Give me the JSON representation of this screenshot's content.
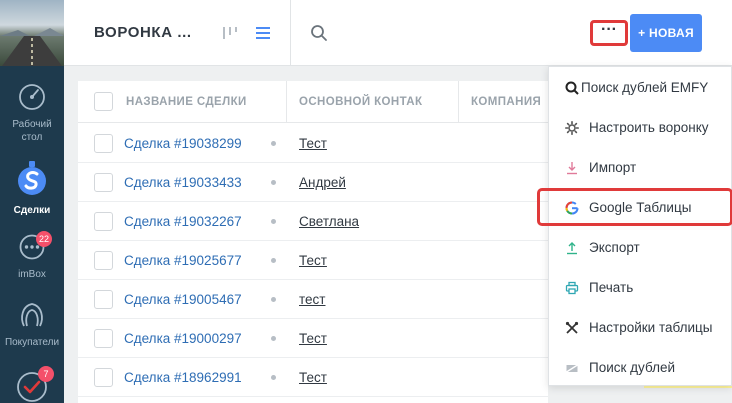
{
  "sidebar": {
    "items": [
      {
        "label": "Рабочий стол",
        "label_line1": "Рабочий",
        "label_line2": "стол",
        "icon": "speedometer-icon"
      },
      {
        "label": "Сделки",
        "icon": "deals-icon",
        "active": true
      },
      {
        "label": "imBox",
        "icon": "chat-icon",
        "badge": "22"
      },
      {
        "label": "Покупатели",
        "icon": "buyers-icon"
      },
      {
        "label": "",
        "icon": "tasks-check-icon",
        "badge": "7"
      }
    ]
  },
  "header": {
    "title": "ВОРОНКА ...",
    "more_label": "···",
    "new_label": "+ НОВАЯ"
  },
  "table": {
    "columns": [
      "НАЗВАНИЕ СДЕЛКИ",
      "ОСНОВНОЙ КОНТАК",
      "КОМПАНИЯ"
    ],
    "rows": [
      {
        "deal": "Сделка #19038299",
        "contact": "Тест"
      },
      {
        "deal": "Сделка #19033433",
        "contact": "Андрей"
      },
      {
        "deal": "Сделка #19032267",
        "contact": "Светлана"
      },
      {
        "deal": "Сделка #19025677",
        "contact": "Тест"
      },
      {
        "deal": "Сделка #19005467",
        "contact": "тест"
      },
      {
        "deal": "Сделка #19000297",
        "contact": "Тест"
      },
      {
        "deal": "Сделка #18962991",
        "contact": "Тест"
      }
    ]
  },
  "menu": {
    "items": [
      {
        "label": "Поиск дублей EMFY",
        "icon": "emfy-search-icon"
      },
      {
        "label": "Настроить воронку",
        "icon": "gear-icon"
      },
      {
        "label": "Импорт",
        "icon": "import-icon"
      },
      {
        "label": "Google Таблицы",
        "icon": "google-icon",
        "highlighted": true
      },
      {
        "label": "Экспорт",
        "icon": "export-icon"
      },
      {
        "label": "Печать",
        "icon": "print-icon"
      },
      {
        "label": "Настройки таблицы",
        "icon": "tools-icon"
      },
      {
        "label": "Поиск дублей",
        "icon": "duplicates-icon"
      }
    ]
  },
  "colors": {
    "sidebar": "#1e3a4d",
    "accent": "#4c8bf5",
    "link": "#2e6db4",
    "highlight": "#e03a3a"
  }
}
